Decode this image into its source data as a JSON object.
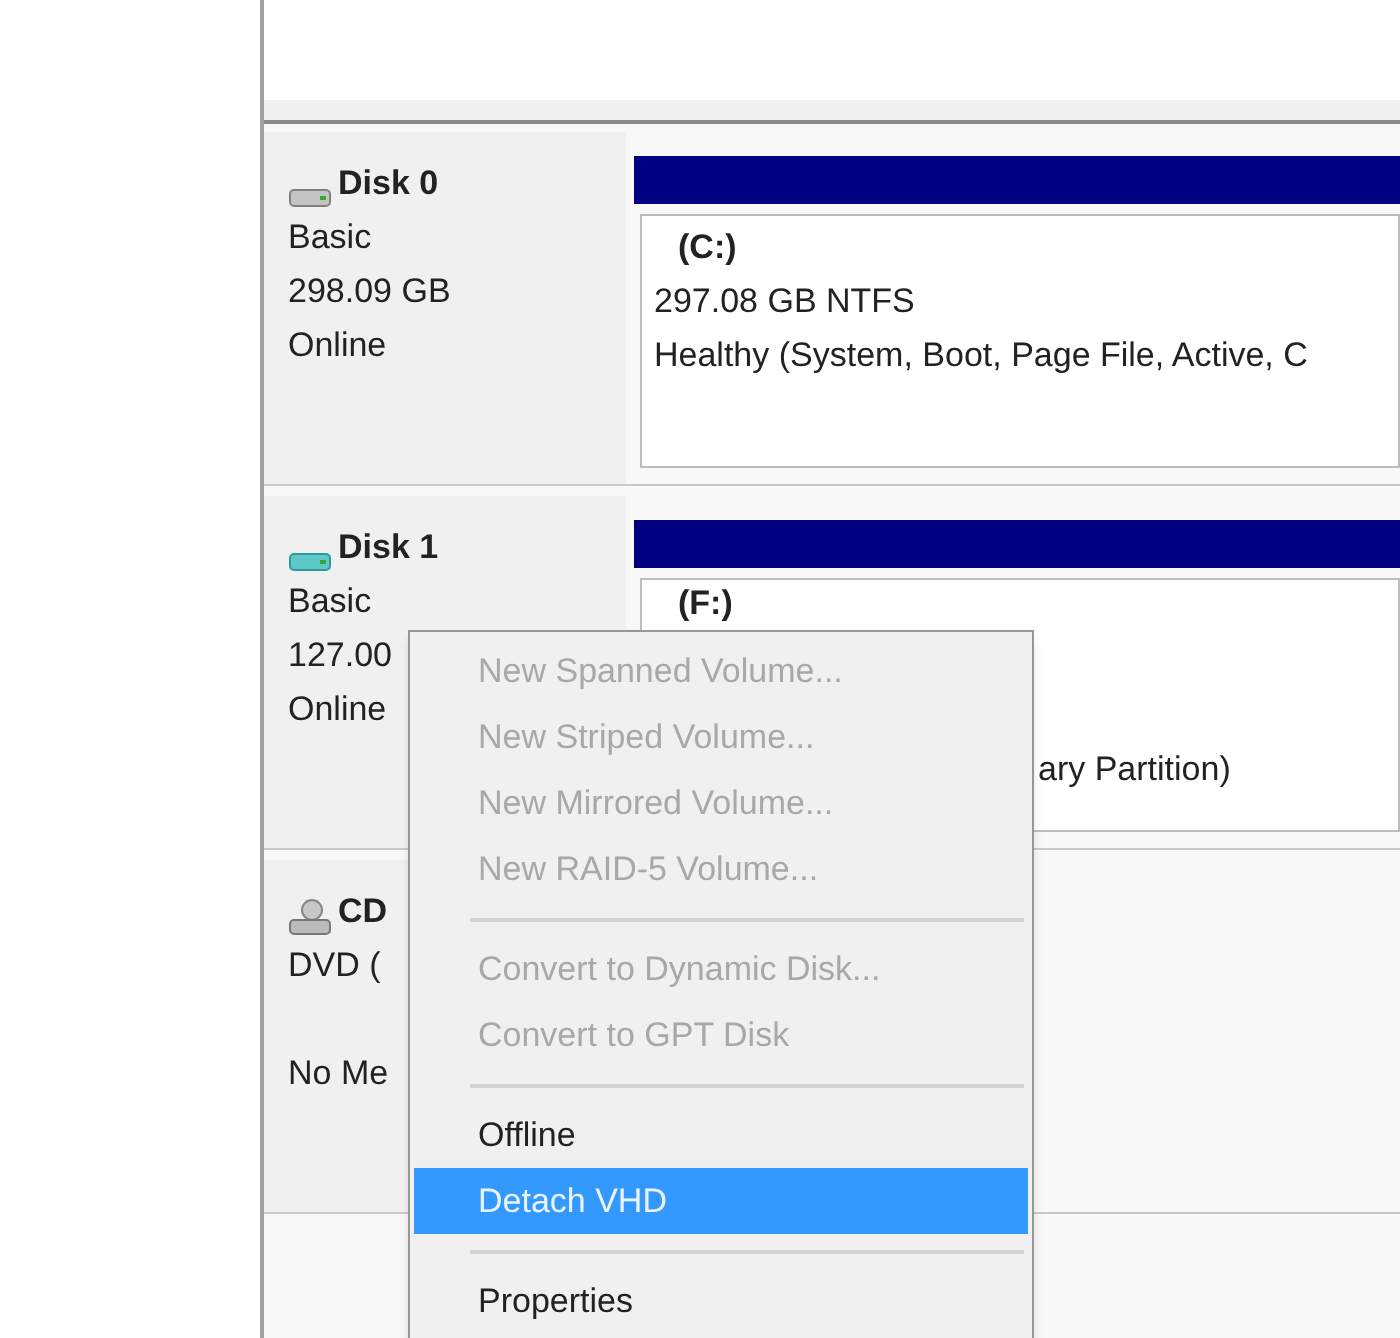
{
  "disks": [
    {
      "kind": "disk",
      "name": "Disk 0",
      "lines": [
        "Basic",
        "298.09 GB",
        "Online"
      ],
      "partition": {
        "label": "(C:)",
        "size": "297.08 GB NTFS",
        "status": "Healthy (System, Boot, Page File, Active, C"
      }
    },
    {
      "kind": "vhd",
      "name": "Disk 1",
      "lines": [
        "Basic",
        "127.00",
        "Online"
      ],
      "partition": {
        "label": "(F:)",
        "status": "ary Partition)"
      }
    },
    {
      "kind": "cdrom",
      "name": "CD",
      "lines": [
        "DVD (",
        "No Me"
      ]
    }
  ],
  "context_menu": [
    {
      "kind": "item",
      "label": "New Spanned Volume...",
      "disabled": true,
      "selected": false
    },
    {
      "kind": "item",
      "label": "New Striped Volume...",
      "disabled": true,
      "selected": false
    },
    {
      "kind": "item",
      "label": "New Mirrored Volume...",
      "disabled": true,
      "selected": false
    },
    {
      "kind": "item",
      "label": "New RAID-5 Volume...",
      "disabled": true,
      "selected": false
    },
    {
      "kind": "separator"
    },
    {
      "kind": "item",
      "label": "Convert to Dynamic Disk...",
      "disabled": true,
      "selected": false
    },
    {
      "kind": "item",
      "label": "Convert to GPT Disk",
      "disabled": true,
      "selected": false
    },
    {
      "kind": "separator"
    },
    {
      "kind": "item",
      "label": "Offline",
      "disabled": false,
      "selected": false
    },
    {
      "kind": "item",
      "label": "Detach VHD",
      "disabled": false,
      "selected": true
    },
    {
      "kind": "separator"
    },
    {
      "kind": "item",
      "label": "Properties",
      "disabled": false,
      "selected": false
    }
  ]
}
